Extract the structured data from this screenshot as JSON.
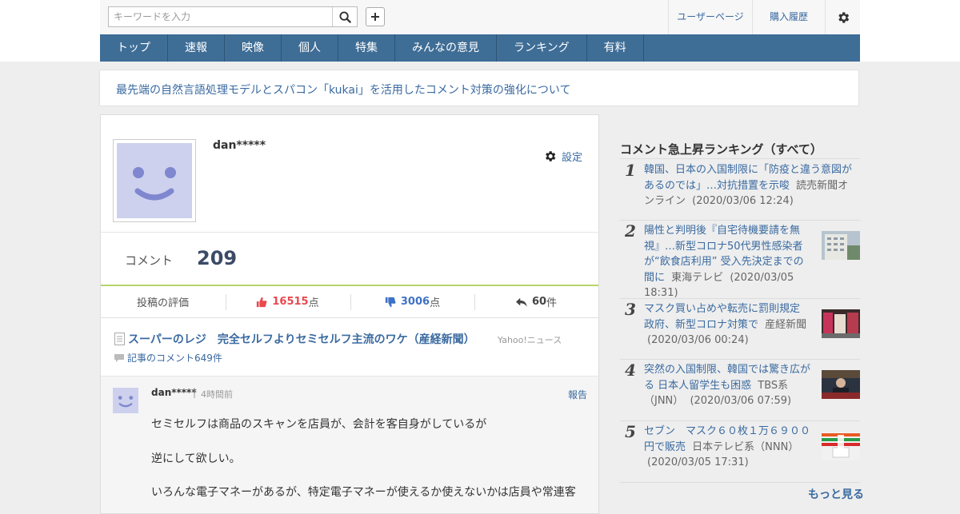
{
  "search": {
    "placeholder": "キーワードを入力"
  },
  "header": {
    "user_page": "ユーザーページ",
    "purchase_history": "購入履歴"
  },
  "nav": [
    "トップ",
    "速報",
    "映像",
    "個人",
    "特集",
    "みんなの意見",
    "ランキング",
    "有料"
  ],
  "notice": "最先端の自然言語処理モデルとスパコン「kukai」を活用したコメント対策の強化について",
  "profile": {
    "username": "dan*****",
    "settings_label": "設定"
  },
  "stats": {
    "comment_label": "コメント",
    "comment_count": "209"
  },
  "evaluation": {
    "label": "投稿の評価",
    "likes": "16515",
    "likes_unit": "点",
    "dislikes": "3006",
    "dislikes_unit": "点",
    "replies": "60",
    "replies_unit": "件"
  },
  "article": {
    "title": "スーパーのレジ　完全セルフよりセミセルフ主流のワケ（産経新聞）",
    "source": "Yahoo!ニュース",
    "comments_link": "記事のコメント649件"
  },
  "comment": {
    "user": "dan*****",
    "time": "4時間前",
    "report": "報告",
    "lines": [
      "セミセルフは商品のスキャンを店員が、会計を客自身がしているが",
      "逆にして欲しい。",
      "いろんな電子マネーがあるが、特定電子マネーが使えるか使えないかは店員や常連客"
    ]
  },
  "sidebar": {
    "title": "コメント急上昇ランキング（すべて）",
    "more": "もっと見る",
    "items": [
      {
        "rank": "1",
        "headline": "韓国、日本の入国制限に「防疫と違う意図があるのでは」…対抗措置を示唆",
        "source": "読売新聞オンライン",
        "date": "(2020/03/06 12:24)"
      },
      {
        "rank": "2",
        "headline": "陽性と判明後『自宅待機要請を無視』…新型コロナ50代男性感染者が“飲食店利用” 受入先決定までの間に",
        "source": "東海テレビ",
        "date": "(2020/03/05 18:31)"
      },
      {
        "rank": "3",
        "headline": "マスク買い占めや転売に罰則規定　政府、新型コロナ対策で",
        "source": "産経新聞",
        "date": "(2020/03/06 00:24)"
      },
      {
        "rank": "4",
        "headline": "突然の入国制限、韓国では驚き広がる 日本人留学生も困惑",
        "source": "TBS系（JNN）",
        "date": "(2020/03/06 07:59)"
      },
      {
        "rank": "5",
        "headline": "セブン　マスク６０枚１万６９００円で販売",
        "source": "日本テレビ系（NNN）",
        "date": "(2020/03/05 17:31)"
      }
    ]
  },
  "colors": {
    "nav": "#3e6d96",
    "link": "#3a6aa0",
    "like": "#e8494f",
    "dislike": "#3f72c6",
    "accent_line": "#b6d46a"
  }
}
